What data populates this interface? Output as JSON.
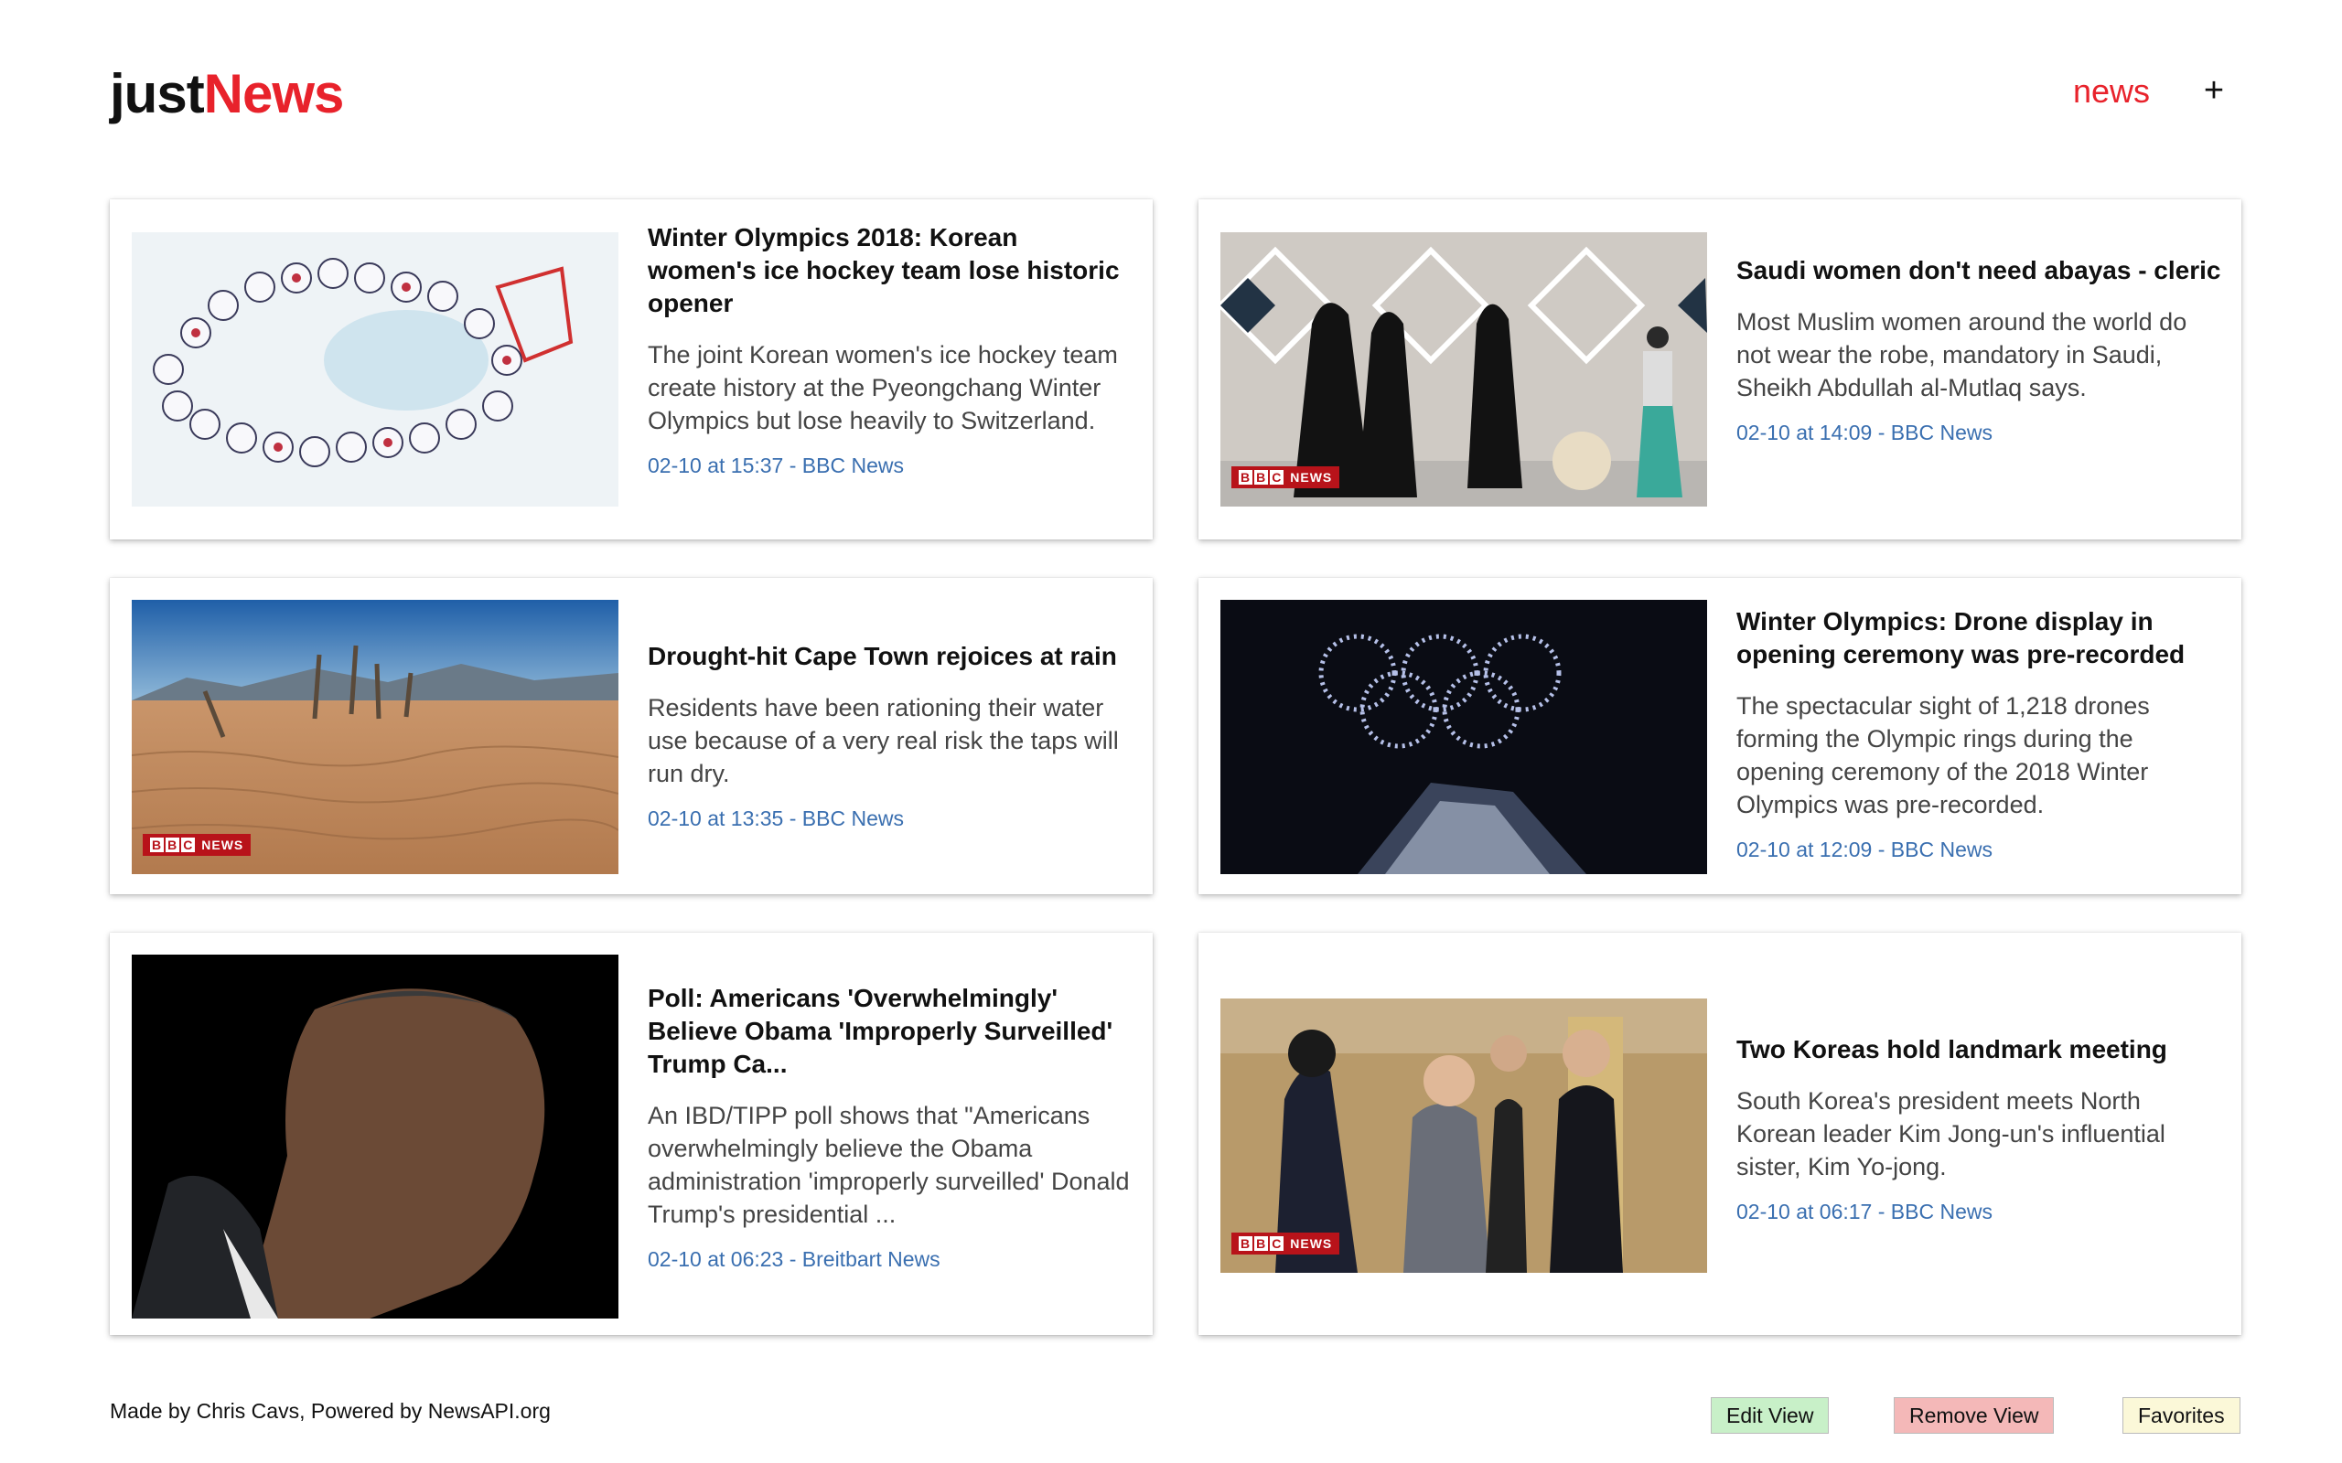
{
  "header": {
    "logo_part1": "just",
    "logo_part2": "News",
    "nav_news": "news",
    "nav_add": "+"
  },
  "articles": [
    {
      "title": "Winter Olympics 2018: Korean women's ice hockey team lose historic opener",
      "description": "The joint Korean women's ice hockey team create history at the Pyeongchang Winter Olympics but lose heavily to Switzerland.",
      "meta": "02-10 at 15:37 - BBC News",
      "badge": false
    },
    {
      "title": "Saudi women don't need abayas - cleric",
      "description": "Most Muslim women around the world do not wear the robe, mandatory in Saudi, Sheikh Abdullah al-Mutlaq says.",
      "meta": "02-10 at 14:09 - BBC News",
      "badge": true
    },
    {
      "title": "Drought-hit Cape Town rejoices at rain",
      "description": "Residents have been rationing their water use because of a very real risk the taps will run dry.",
      "meta": "02-10 at 13:35 - BBC News",
      "badge": true
    },
    {
      "title": "Winter Olympics: Drone display in opening ceremony was pre-recorded",
      "description": "The spectacular sight of 1,218 drones forming the Olympic rings during the opening ceremony of the 2018 Winter Olympics was pre-recorded.",
      "meta": "02-10 at 12:09 - BBC News",
      "badge": false
    },
    {
      "title": "Poll: Americans 'Overwhelmingly' Believe Obama 'Improperly Surveilled' Trump Ca...",
      "description": "An IBD/TIPP poll shows that \"Americans overwhelmingly believe the Obama administration 'improperly surveilled' Donald Trump's presidential ...",
      "meta": "02-10 at 06:23 - Breitbart News",
      "badge": false
    },
    {
      "title": "Two Koreas hold landmark meeting",
      "description": "South Korea's president meets North Korean leader Kim Jong-un's influential sister, Kim Yo-jong.",
      "meta": "02-10 at 06:17 - BBC News",
      "badge": true
    }
  ],
  "badge": {
    "b1": "B",
    "b2": "B",
    "b3": "C",
    "text": "NEWS"
  },
  "footer": {
    "credit": "Made by Chris Cavs, Powered by NewsAPI.org",
    "edit_view": "Edit View",
    "remove_view": "Remove View",
    "favorites": "Favorites"
  },
  "colors": {
    "brand_red": "#e8222b",
    "meta_blue": "#3a6fb0",
    "edit_green": "#c8f0c8",
    "remove_red": "#f4b8b8",
    "fav_yellow": "#fbf8d8"
  }
}
